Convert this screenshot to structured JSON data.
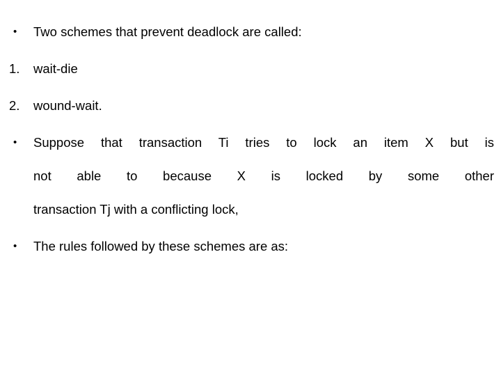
{
  "slide": {
    "background_color": "#ffffff",
    "text_color": "#000000",
    "blocks": [
      {
        "marker": "•",
        "marker_type": "bullet",
        "text": "Two schemes that prevent deadlock are called:"
      },
      {
        "marker": "1.",
        "marker_type": "decimal",
        "text": "wait-die"
      },
      {
        "marker": "2.",
        "marker_type": "decimal",
        "text": "wound-wait."
      },
      {
        "marker": "•",
        "marker_type": "bullet",
        "line1": "Suppose that transaction Ti tries to lock an item X but is",
        "line2": "not able to because X is locked by some other",
        "line3": "transaction Tj with a conflicting lock,"
      },
      {
        "marker": "•",
        "marker_type": "bullet",
        "text": "The rules followed by these schemes are as:"
      }
    ]
  }
}
